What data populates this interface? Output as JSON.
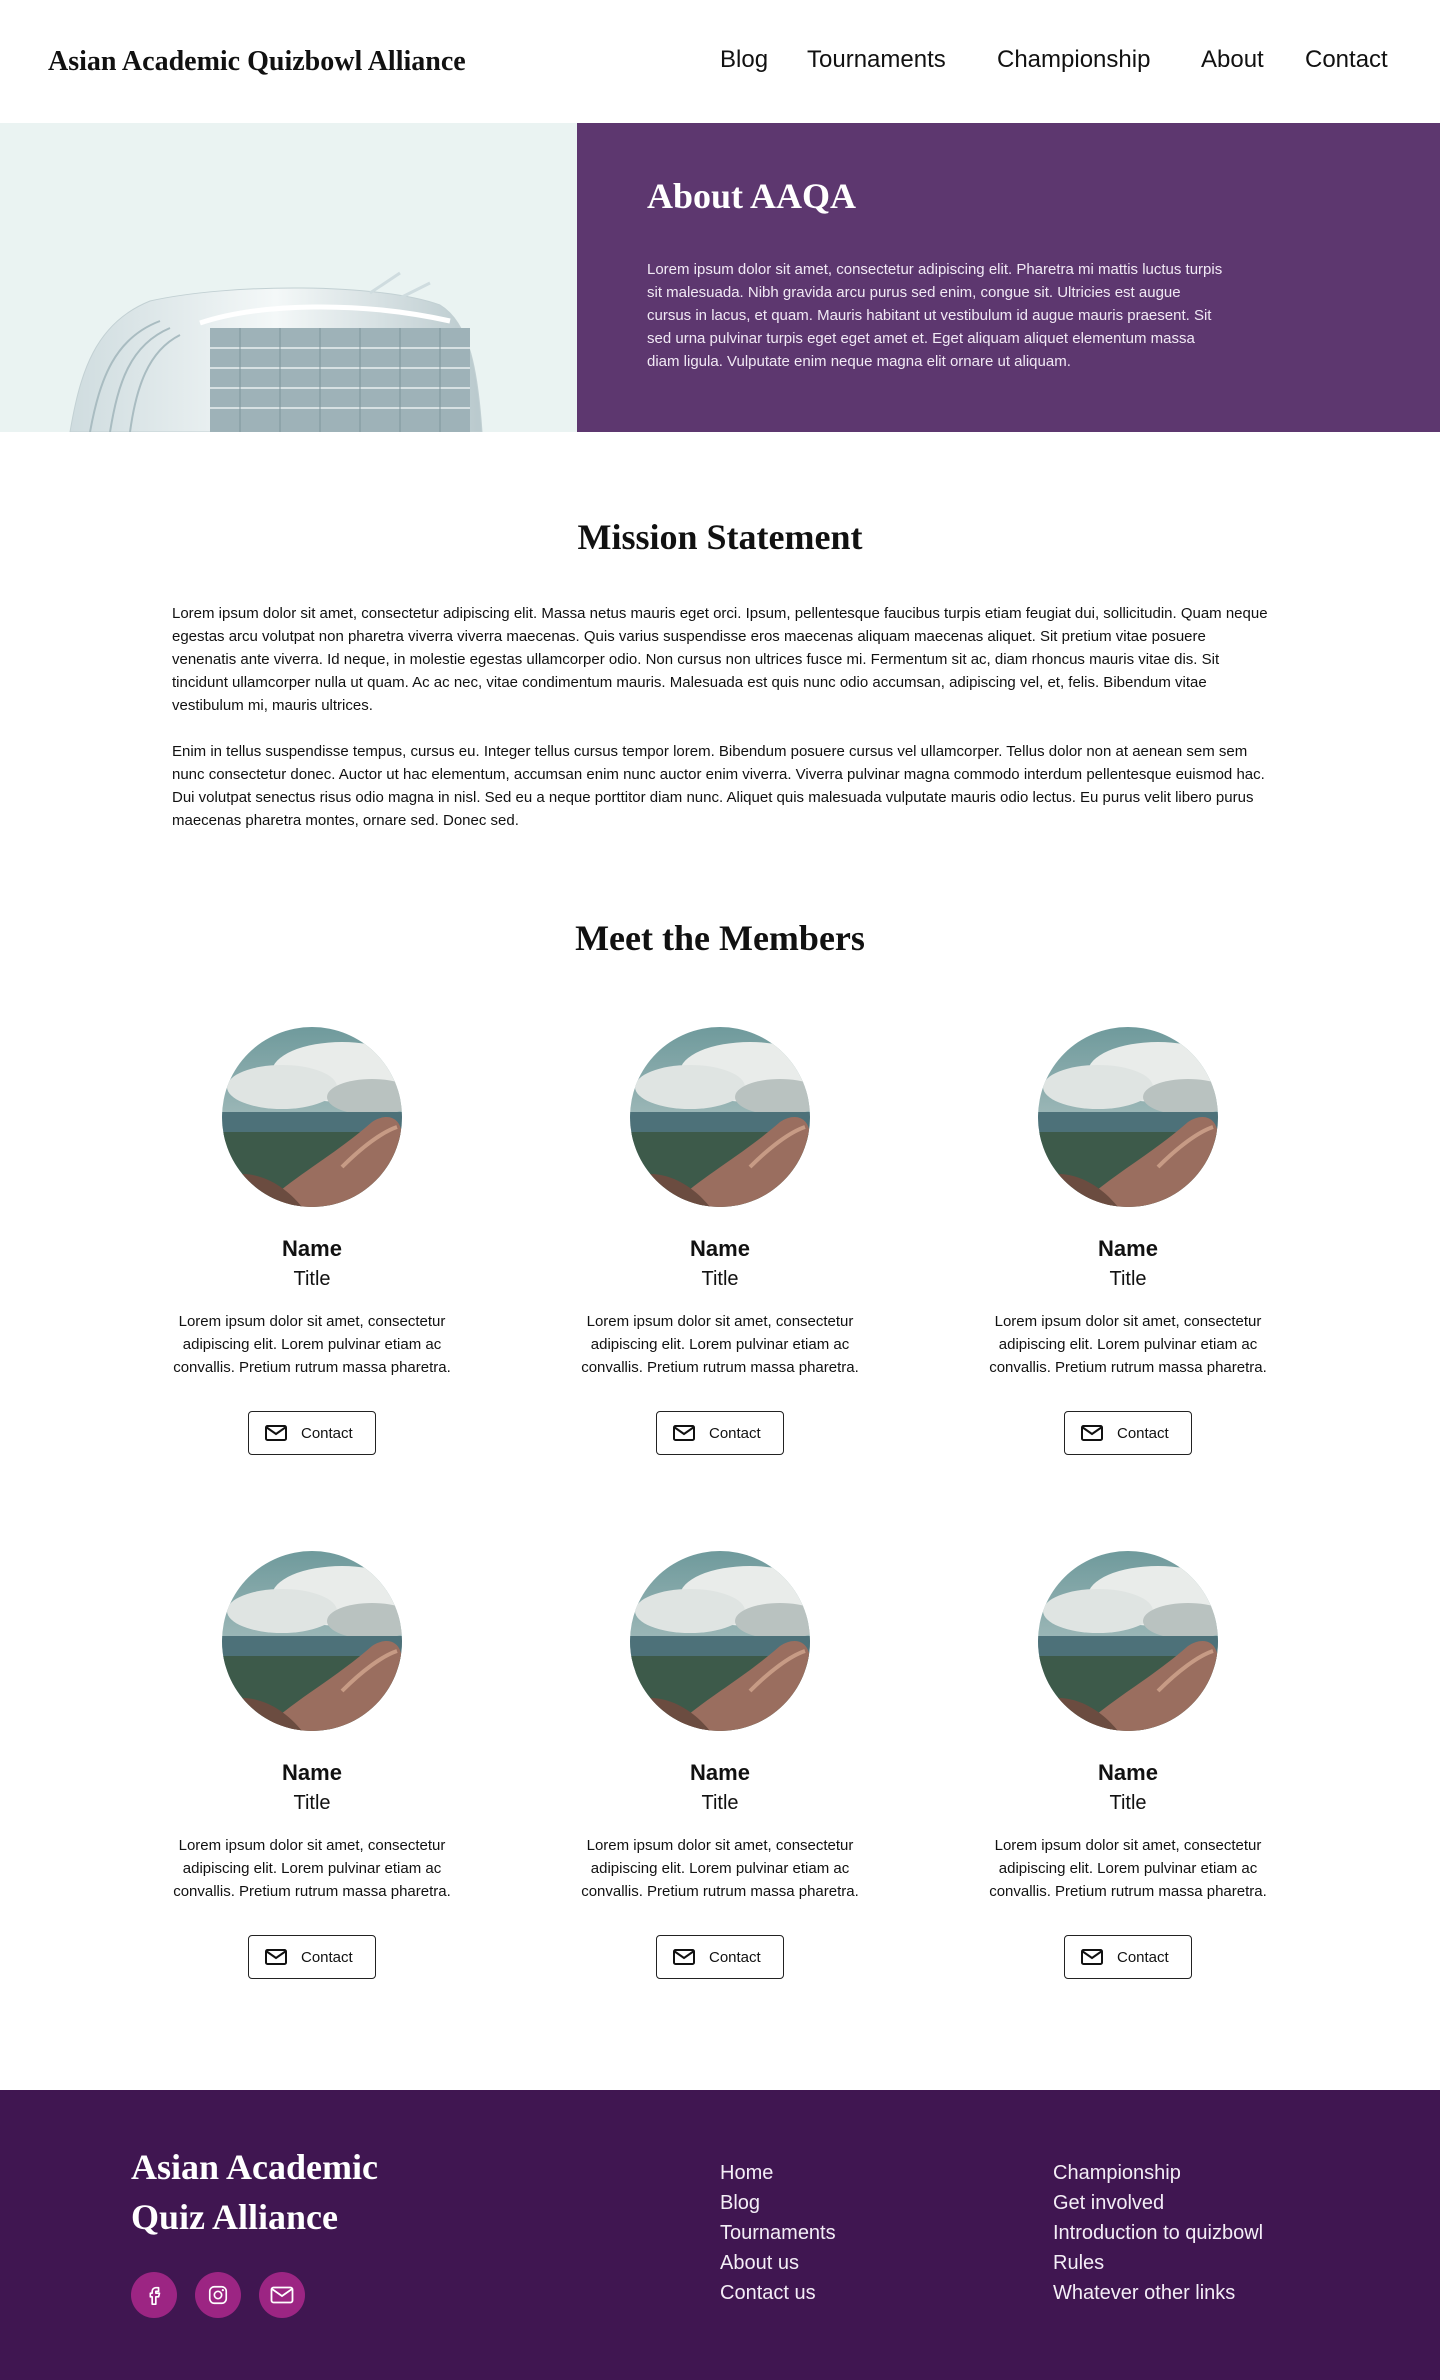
{
  "header": {
    "brand": "Asian Academic Quizbowl Alliance",
    "nav": [
      "Blog",
      "Tournaments",
      "Championship",
      "About",
      "Contact"
    ]
  },
  "hero": {
    "title": "About AAQA",
    "text": "Lorem ipsum dolor sit amet, consectetur adipiscing elit. Pharetra mi mattis luctus turpis sit malesuada. Nibh gravida arcu purus sed enim, congue sit. Ultricies est augue cursus in lacus, et quam. Mauris habitant ut vestibulum id augue mauris praesent. Sit sed urna pulvinar turpis eget eget amet et. Eget aliquam aliquet elementum massa diam ligula. Vulputate enim neque magna elit ornare ut aliquam.",
    "image_icon": "building-photo"
  },
  "mission": {
    "title": "Mission Statement",
    "paragraphs": [
      "Lorem ipsum dolor sit amet, consectetur adipiscing elit. Massa netus mauris eget orci. Ipsum, pellentesque faucibus turpis etiam feugiat dui, sollicitudin. Quam neque egestas arcu volutpat non pharetra viverra viverra maecenas. Quis varius suspendisse eros maecenas aliquam maecenas aliquet. Sit pretium vitae posuere venenatis ante viverra. Id neque, in molestie egestas ullamcorper odio. Non cursus non ultrices fusce mi. Fermentum sit ac, diam rhoncus mauris vitae dis. Sit tincidunt ullamcorper nulla ut quam. Ac ac nec, vitae condimentum mauris. Malesuada est quis nunc odio accumsan, adipiscing vel, et, felis. Bibendum vitae vestibulum mi, mauris ultrices.",
      "Enim in tellus suspendisse tempus, cursus eu. Integer tellus cursus tempor lorem. Bibendum posuere cursus vel ullamcorper. Tellus dolor non at aenean sem sem nunc consectetur donec. Auctor ut hac elementum, accumsan enim nunc auctor enim viverra. Viverra pulvinar magna commodo interdum pellentesque euismod hac. Dui volutpat senectus risus odio magna in nisl. Sed eu a neque porttitor diam nunc. Aliquet quis malesuada vulputate mauris odio lectus. Eu purus velit libero purus maecenas pharetra montes, ornare sed. Donec sed."
    ]
  },
  "members": {
    "title": "Meet the Members",
    "items": [
      {
        "name": "Name",
        "title": "Title",
        "bio": "Lorem ipsum dolor sit amet, consectetur adipiscing elit. Lorem pulvinar etiam ac convallis. Pretium rutrum massa pharetra.",
        "button": "Contact"
      },
      {
        "name": "Name",
        "title": "Title",
        "bio": "Lorem ipsum dolor sit amet, consectetur adipiscing elit. Lorem pulvinar etiam ac convallis. Pretium rutrum massa pharetra.",
        "button": "Contact"
      },
      {
        "name": "Name",
        "title": "Title",
        "bio": "Lorem ipsum dolor sit amet, consectetur adipiscing elit. Lorem pulvinar etiam ac convallis. Pretium rutrum massa pharetra.",
        "button": "Contact"
      },
      {
        "name": "Name",
        "title": "Title",
        "bio": "Lorem ipsum dolor sit amet, consectetur adipiscing elit. Lorem pulvinar etiam ac convallis. Pretium rutrum massa pharetra.",
        "button": "Contact"
      },
      {
        "name": "Name",
        "title": "Title",
        "bio": "Lorem ipsum dolor sit amet, consectetur adipiscing elit. Lorem pulvinar etiam ac convallis. Pretium rutrum massa pharetra.",
        "button": "Contact"
      },
      {
        "name": "Name",
        "title": "Title",
        "bio": "Lorem ipsum dolor sit amet, consectetur adipiscing elit. Lorem pulvinar etiam ac convallis. Pretium rutrum massa pharetra.",
        "button": "Contact"
      }
    ]
  },
  "footer": {
    "brand": "Asian Academic Quiz Alliance",
    "socials": [
      "facebook-icon",
      "instagram-icon",
      "mail-icon"
    ],
    "col1": [
      "Home",
      "Blog",
      "Tournaments",
      "About us",
      "Contact us"
    ],
    "col2": [
      "Championship",
      "Get involved",
      "Introduction to quizbowl",
      "Rules",
      "Whatever other links"
    ]
  },
  "colors": {
    "hero_panel": "#5d376f",
    "footer_bg": "#401651",
    "social_bg": "#9c2583"
  }
}
